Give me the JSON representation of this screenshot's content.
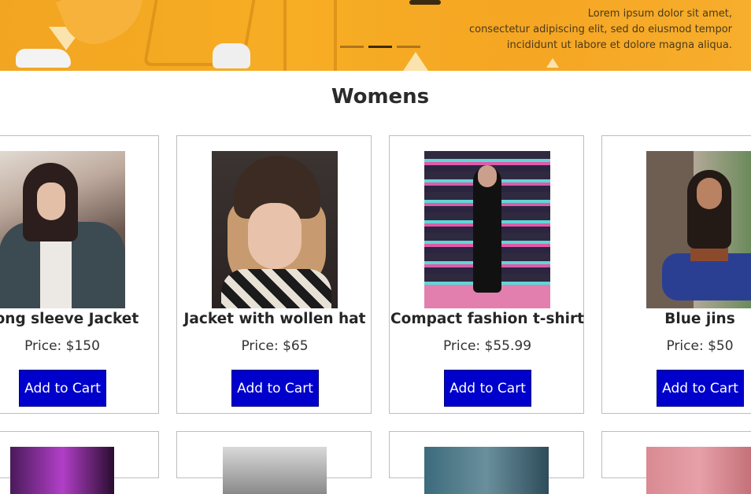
{
  "hero": {
    "text_lines": [
      "Lorem ipsum dolor sit amet,",
      "consectetur adipiscing elit, sed do eiusmod tempor",
      "incididunt ut labore et dolore magna aliqua."
    ],
    "carousel": {
      "slides": 3,
      "active": 2
    }
  },
  "section": {
    "title": "Womens"
  },
  "products": [
    {
      "name": "Long sleeve Jacket",
      "price": "Price: $150",
      "button": "Add to Cart"
    },
    {
      "name": "Jacket with wollen hat",
      "price": "Price: $65",
      "button": "Add to Cart"
    },
    {
      "name": "Compact fashion t-shirt",
      "price": "Price: $55.99",
      "button": "Add to Cart"
    },
    {
      "name": "Blue jins",
      "price": "Price: $50",
      "button": "Add to Cart"
    }
  ],
  "colors": {
    "banner": "#f5a623",
    "button": "#0000cc",
    "card_border": "#bdbdbd"
  }
}
